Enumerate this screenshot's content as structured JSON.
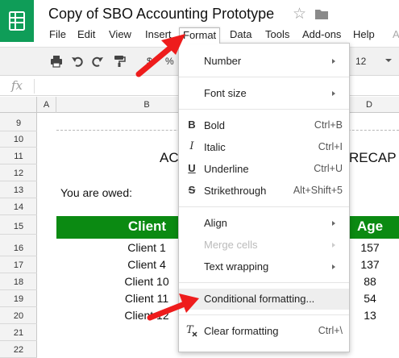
{
  "app": {
    "doc_title": "Copy of SBO Accounting Prototype",
    "logo_icon": "sheets-logo-icon",
    "star_icon": "star-outline-icon",
    "folder_icon": "folder-icon"
  },
  "menubar": {
    "items": [
      "File",
      "Edit",
      "View",
      "Insert",
      "Format",
      "Data",
      "Tools",
      "Add-ons",
      "Help",
      "A"
    ],
    "active": "Format"
  },
  "toolbar": {
    "print_icon": "print-icon",
    "undo_icon": "undo-icon",
    "redo_icon": "redo-icon",
    "paint_format_icon": "paint-format-icon",
    "currency_label": "$",
    "percent_label": "%",
    "font_size_value": "12"
  },
  "formula_bar": {
    "fx_label": "fx"
  },
  "columns": [
    "A",
    "B",
    "D"
  ],
  "rows": [
    "9",
    "10",
    "11",
    "12",
    "13",
    "14",
    "15",
    "16",
    "17",
    "18",
    "19",
    "20",
    "21",
    "22"
  ],
  "sheet": {
    "recap_left": "AC",
    "recap_right": "RECAP",
    "owed_label": "You are owed:",
    "header_client": "Client",
    "header_age": "Age",
    "clients": [
      "Client 1",
      "Client 4",
      "Client 10",
      "Client 11",
      "Client 12"
    ],
    "ages": [
      "157",
      "137",
      "88",
      "54",
      "13"
    ],
    "header_color": "#0b8a12"
  },
  "format_menu": {
    "number": "Number",
    "font_size": "Font size",
    "bold": "Bold",
    "bold_shortcut": "Ctrl+B",
    "italic": "Italic",
    "italic_shortcut": "Ctrl+I",
    "underline": "Underline",
    "underline_shortcut": "Ctrl+U",
    "strikethrough": "Strikethrough",
    "strikethrough_shortcut": "Alt+Shift+5",
    "align": "Align",
    "merge_cells": "Merge cells",
    "text_wrapping": "Text wrapping",
    "conditional_formatting": "Conditional formatting...",
    "clear_formatting": "Clear formatting",
    "clear_formatting_shortcut": "Ctrl+\\",
    "bold_icon_glyph": "B",
    "italic_icon_glyph": "I",
    "underline_icon_glyph": "U",
    "strike_icon_glyph": "S"
  },
  "annotation_color": "#ee1c1c"
}
